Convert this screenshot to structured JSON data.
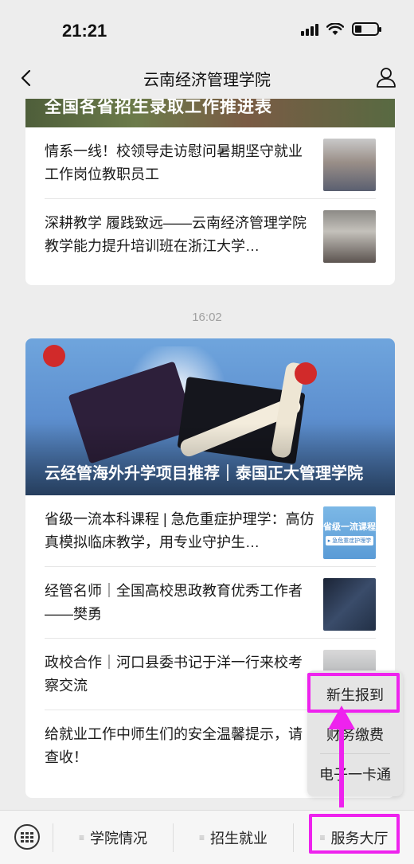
{
  "status_bar": {
    "time": "21:21"
  },
  "nav": {
    "title": "云南经济管理学院"
  },
  "feed": {
    "card1": {
      "banner_title": "全国各省招生录取工作推进表",
      "items": [
        {
          "text": "情系一线！校领导走访慰问暑期坚守就业工作岗位教职员工",
          "thumb": "photo-leaders"
        },
        {
          "text": "深耕教学 履践致远——云南经济管理学院教学能力提升培训班在浙江大学…",
          "thumb": "photo-classroom"
        }
      ]
    },
    "timestamp": "16:02",
    "card2": {
      "banner_title": "云经管海外升学项目推荐｜泰国正大管理学院",
      "items": [
        {
          "text": "省级一流本科课程 | 急危重症护理学：高仿真模拟临床教学，用专业守护生…",
          "thumb": "course-graphic",
          "thumb_title": "省级一流课程",
          "thumb_sub": "▸ 急危重症护理学"
        },
        {
          "text": "经管名师｜全国高校思政教育优秀工作者——樊勇",
          "thumb": "photo-teacher"
        },
        {
          "text": "政校合作｜河口县委书记于洋一行来校考察交流",
          "thumb": "photo-meeting"
        },
        {
          "text": "给就业工作中师生们的安全温馨提示，请查收！",
          "thumb": ""
        }
      ]
    }
  },
  "bottom_menu": {
    "tabs": [
      {
        "label": "学院情况"
      },
      {
        "label": "招生就业"
      },
      {
        "label": "服务大厅"
      }
    ]
  },
  "submenu": {
    "items": [
      {
        "label": "新生报到"
      },
      {
        "label": "财务缴费"
      },
      {
        "label": "电子一卡通"
      }
    ]
  },
  "colors": {
    "highlight": "#ee22ee",
    "background": "#ededed"
  },
  "icons": {
    "back": "chevron-left-icon",
    "profile": "person-icon",
    "keyboard": "keyboard-icon"
  }
}
